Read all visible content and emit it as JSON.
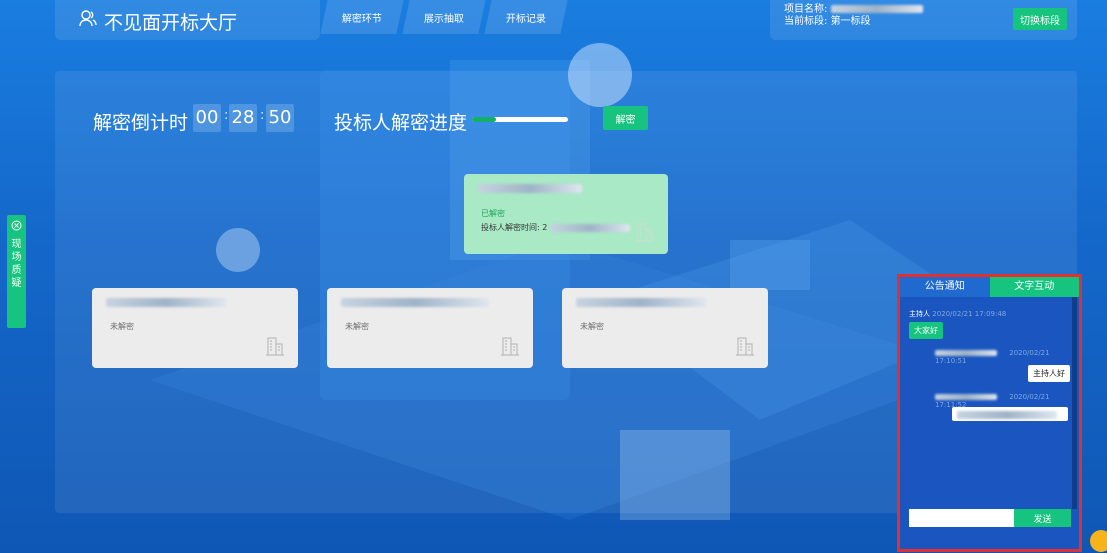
{
  "header": {
    "title": "不见面开标大厅",
    "tabs": [
      {
        "label": "解密环节"
      },
      {
        "label": "展示抽取"
      },
      {
        "label": "开标记录"
      }
    ],
    "project_name_label": "项目名称:",
    "current_section_label": "当前标段:",
    "current_section_value": "第一标段",
    "switch_section_button": "切换标段"
  },
  "countdown": {
    "label": "解密倒计时",
    "hours": "00",
    "minutes": "28",
    "seconds": "50",
    "separator": ":"
  },
  "progress": {
    "label": "投标人解密进度",
    "fraction": 0.25
  },
  "decrypt_button": "解密",
  "bidder_cards": [
    {
      "status": "已解密",
      "time_label": "投标人解密时间: 2",
      "decrypted": true
    },
    {
      "status": "未解密",
      "decrypted": false
    },
    {
      "status": "未解密",
      "decrypted": false
    },
    {
      "status": "未解密",
      "decrypted": false
    }
  ],
  "side_tab": {
    "label": "现场质疑"
  },
  "chat": {
    "tabs": [
      {
        "label": "公告通知"
      },
      {
        "label": "文字互动"
      }
    ],
    "messages": [
      {
        "sender": "主持人",
        "time": "2020/02/21 17:09:48",
        "text": "大家好"
      },
      {
        "time": "2020/02/21 17:10:51",
        "text": "主持人好"
      },
      {
        "time": "2020/02/21 17:11:52"
      }
    ],
    "send_button": "发送"
  },
  "colors": {
    "accent_green": "#16c47f",
    "panel_blue": "#1a55c0",
    "highlight_red": "#e23030"
  }
}
